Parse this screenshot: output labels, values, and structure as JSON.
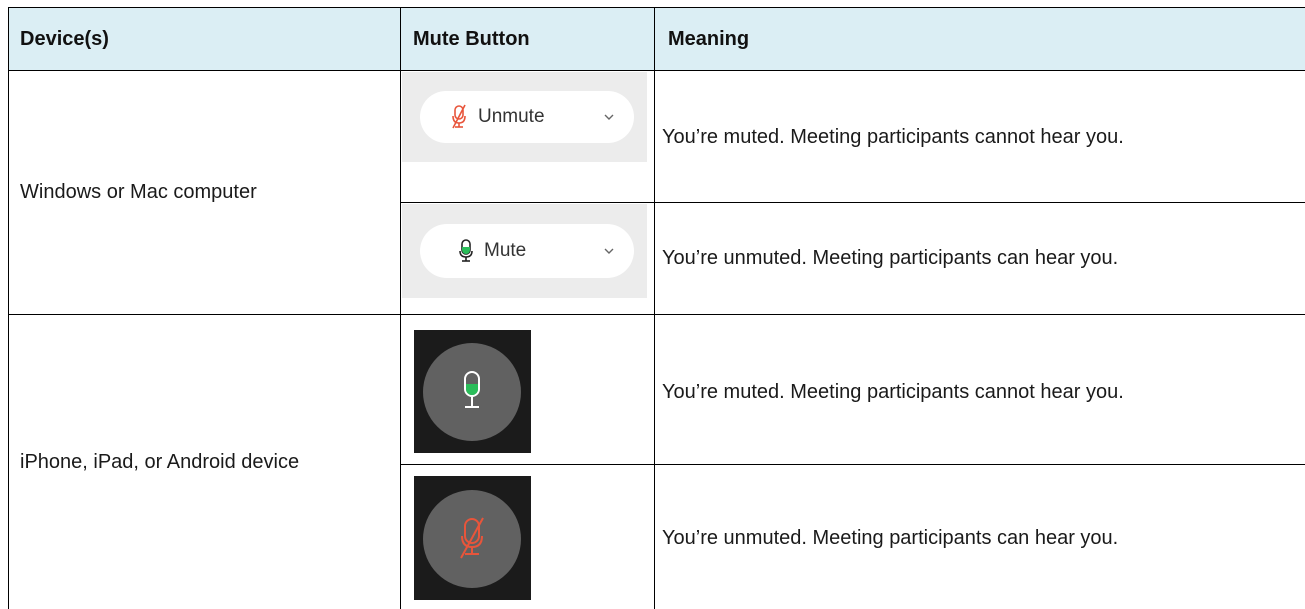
{
  "table": {
    "headers": {
      "device": "Device(s)",
      "mute_button": "Mute Button",
      "meaning": "Meaning"
    },
    "groups": [
      {
        "device": "Windows or Mac computer",
        "rows": [
          {
            "button_label": "Unmute",
            "icon": "mic-muted-icon",
            "meaning": "You’re muted. Meeting participants cannot hear you."
          },
          {
            "button_label": "Mute",
            "icon": "mic-active-icon",
            "meaning": "You’re unmuted. Meeting participants can hear you."
          }
        ]
      },
      {
        "device": "iPhone, iPad, or Android device",
        "rows": [
          {
            "icon": "mic-active-icon",
            "meaning": "You’re muted. Meeting participants cannot hear you."
          },
          {
            "icon": "mic-muted-icon",
            "meaning": "You’re unmuted. Meeting participants can hear you."
          }
        ]
      }
    ]
  },
  "colors": {
    "header_background": "#dbeef4",
    "muted_red": "#e8553b",
    "active_green": "#2bbd5a",
    "mobile_background": "#1b1b1b",
    "mobile_circle": "#616161"
  }
}
